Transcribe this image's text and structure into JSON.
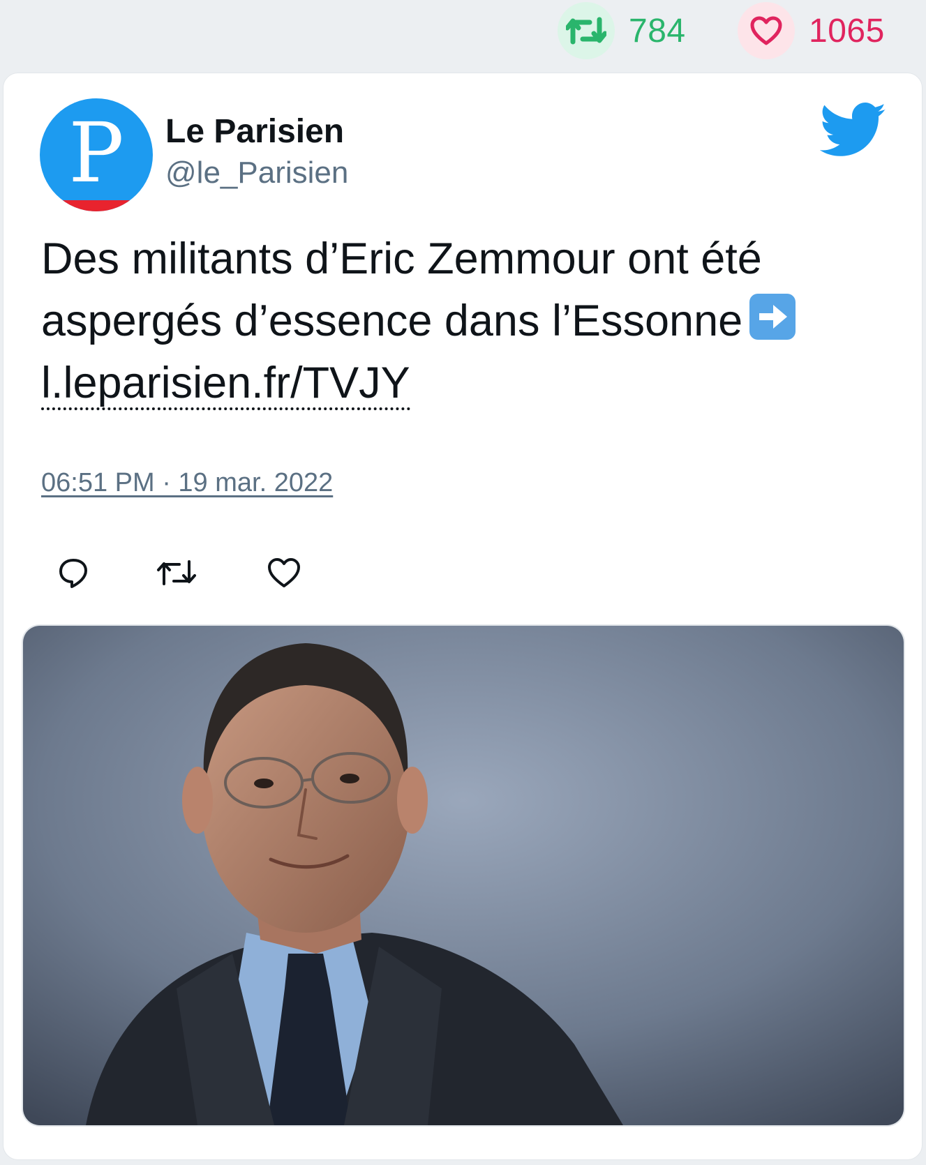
{
  "stats": {
    "retweet_icon": "retweet-icon",
    "retweet_count": "784",
    "like_icon": "heart-icon",
    "like_count": "1065"
  },
  "tweet": {
    "author_name": "Le Parisien",
    "author_handle": "@le_Parisien",
    "avatar_letter": "P",
    "text_main": "Des militants d’Eric Zemmour ont été aspergés d’essence dans l’Essonne",
    "emoji": "arrow-right-emoji",
    "link_text": "l.leparisien.fr/TVJY",
    "timestamp": "06:51 PM · 19 mar. 2022",
    "image_icon": "photo-portrait"
  },
  "colors": {
    "twitter_blue": "#1d9bf0",
    "retweet_green": "#2ab56c",
    "like_red": "#e0245e",
    "text_gray": "#5b7083"
  }
}
